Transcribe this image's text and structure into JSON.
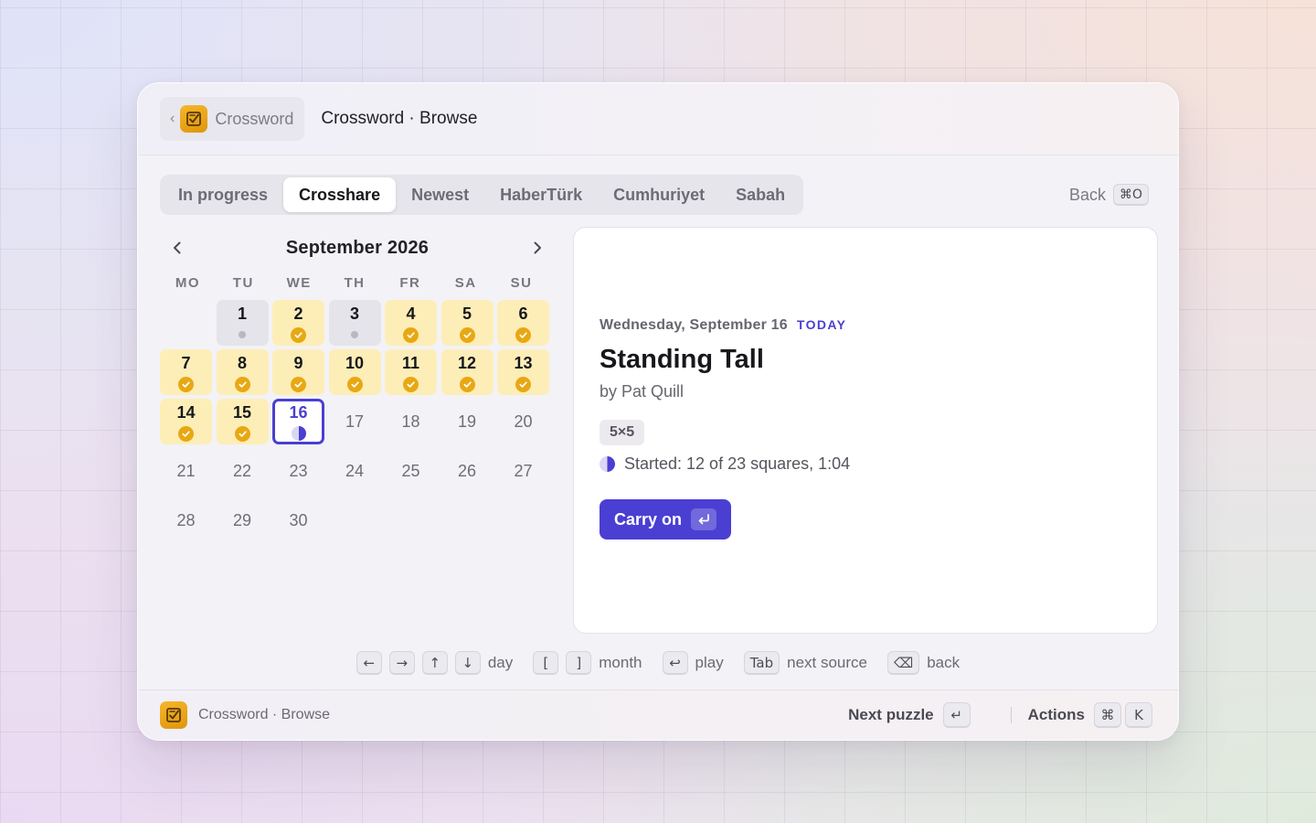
{
  "header": {
    "back_label": "Crossword",
    "title": "Crossword · Browse"
  },
  "tabs": [
    {
      "label": "In progress",
      "active": false
    },
    {
      "label": "Crosshare",
      "active": true
    },
    {
      "label": "Newest",
      "active": false
    },
    {
      "label": "HaberTürk",
      "active": false
    },
    {
      "label": "Cumhuriyet",
      "active": false
    },
    {
      "label": "Sabah",
      "active": false
    }
  ],
  "back_action": {
    "label": "Back",
    "shortcut": "⌘O"
  },
  "calendar": {
    "month_title": "September 2026",
    "weekdays": [
      "MO",
      "TU",
      "WE",
      "TH",
      "FR",
      "SA",
      "SU"
    ],
    "leading_blanks": 1,
    "days": [
      {
        "n": "1",
        "status": "started"
      },
      {
        "n": "2",
        "status": "solved"
      },
      {
        "n": "3",
        "status": "started"
      },
      {
        "n": "4",
        "status": "solved"
      },
      {
        "n": "5",
        "status": "solved"
      },
      {
        "n": "6",
        "status": "solved"
      },
      {
        "n": "7",
        "status": "solved"
      },
      {
        "n": "8",
        "status": "solved"
      },
      {
        "n": "9",
        "status": "solved"
      },
      {
        "n": "10",
        "status": "solved"
      },
      {
        "n": "11",
        "status": "solved"
      },
      {
        "n": "12",
        "status": "solved"
      },
      {
        "n": "13",
        "status": "solved"
      },
      {
        "n": "14",
        "status": "solved"
      },
      {
        "n": "15",
        "status": "solved"
      },
      {
        "n": "16",
        "status": "today"
      },
      {
        "n": "17",
        "status": "none"
      },
      {
        "n": "18",
        "status": "none"
      },
      {
        "n": "19",
        "status": "none"
      },
      {
        "n": "20",
        "status": "none"
      },
      {
        "n": "21",
        "status": "none"
      },
      {
        "n": "22",
        "status": "none"
      },
      {
        "n": "23",
        "status": "none"
      },
      {
        "n": "24",
        "status": "none"
      },
      {
        "n": "25",
        "status": "none"
      },
      {
        "n": "26",
        "status": "none"
      },
      {
        "n": "27",
        "status": "none"
      },
      {
        "n": "28",
        "status": "none"
      },
      {
        "n": "29",
        "status": "none"
      },
      {
        "n": "30",
        "status": "none"
      }
    ]
  },
  "detail": {
    "date": "Wednesday, September 16",
    "today_badge": "TODAY",
    "title": "Standing Tall",
    "author": "by Pat Quill",
    "size": "5×5",
    "status": "Started: 12 of 23 squares, 1:04",
    "cta_label": "Carry on"
  },
  "hints": {
    "day_keys": [
      "←",
      "→",
      "↑",
      "↓"
    ],
    "day_label": "day",
    "month_keys": [
      "[",
      "]"
    ],
    "month_label": "month",
    "play_key": "↩",
    "play_label": "play",
    "source_key": "Tab",
    "source_label": "next source",
    "back_key": "⌫",
    "back_label": "back"
  },
  "footer": {
    "title": "Crossword · Browse",
    "next_label": "Next puzzle",
    "next_key": "↵",
    "actions_label": "Actions",
    "actions_keys": [
      "⌘",
      "K"
    ]
  },
  "colors": {
    "accent": "#4a3fd2",
    "solved_bg": "#fdeeb8",
    "check": "#e8a814",
    "brand": "#f0a61a"
  }
}
